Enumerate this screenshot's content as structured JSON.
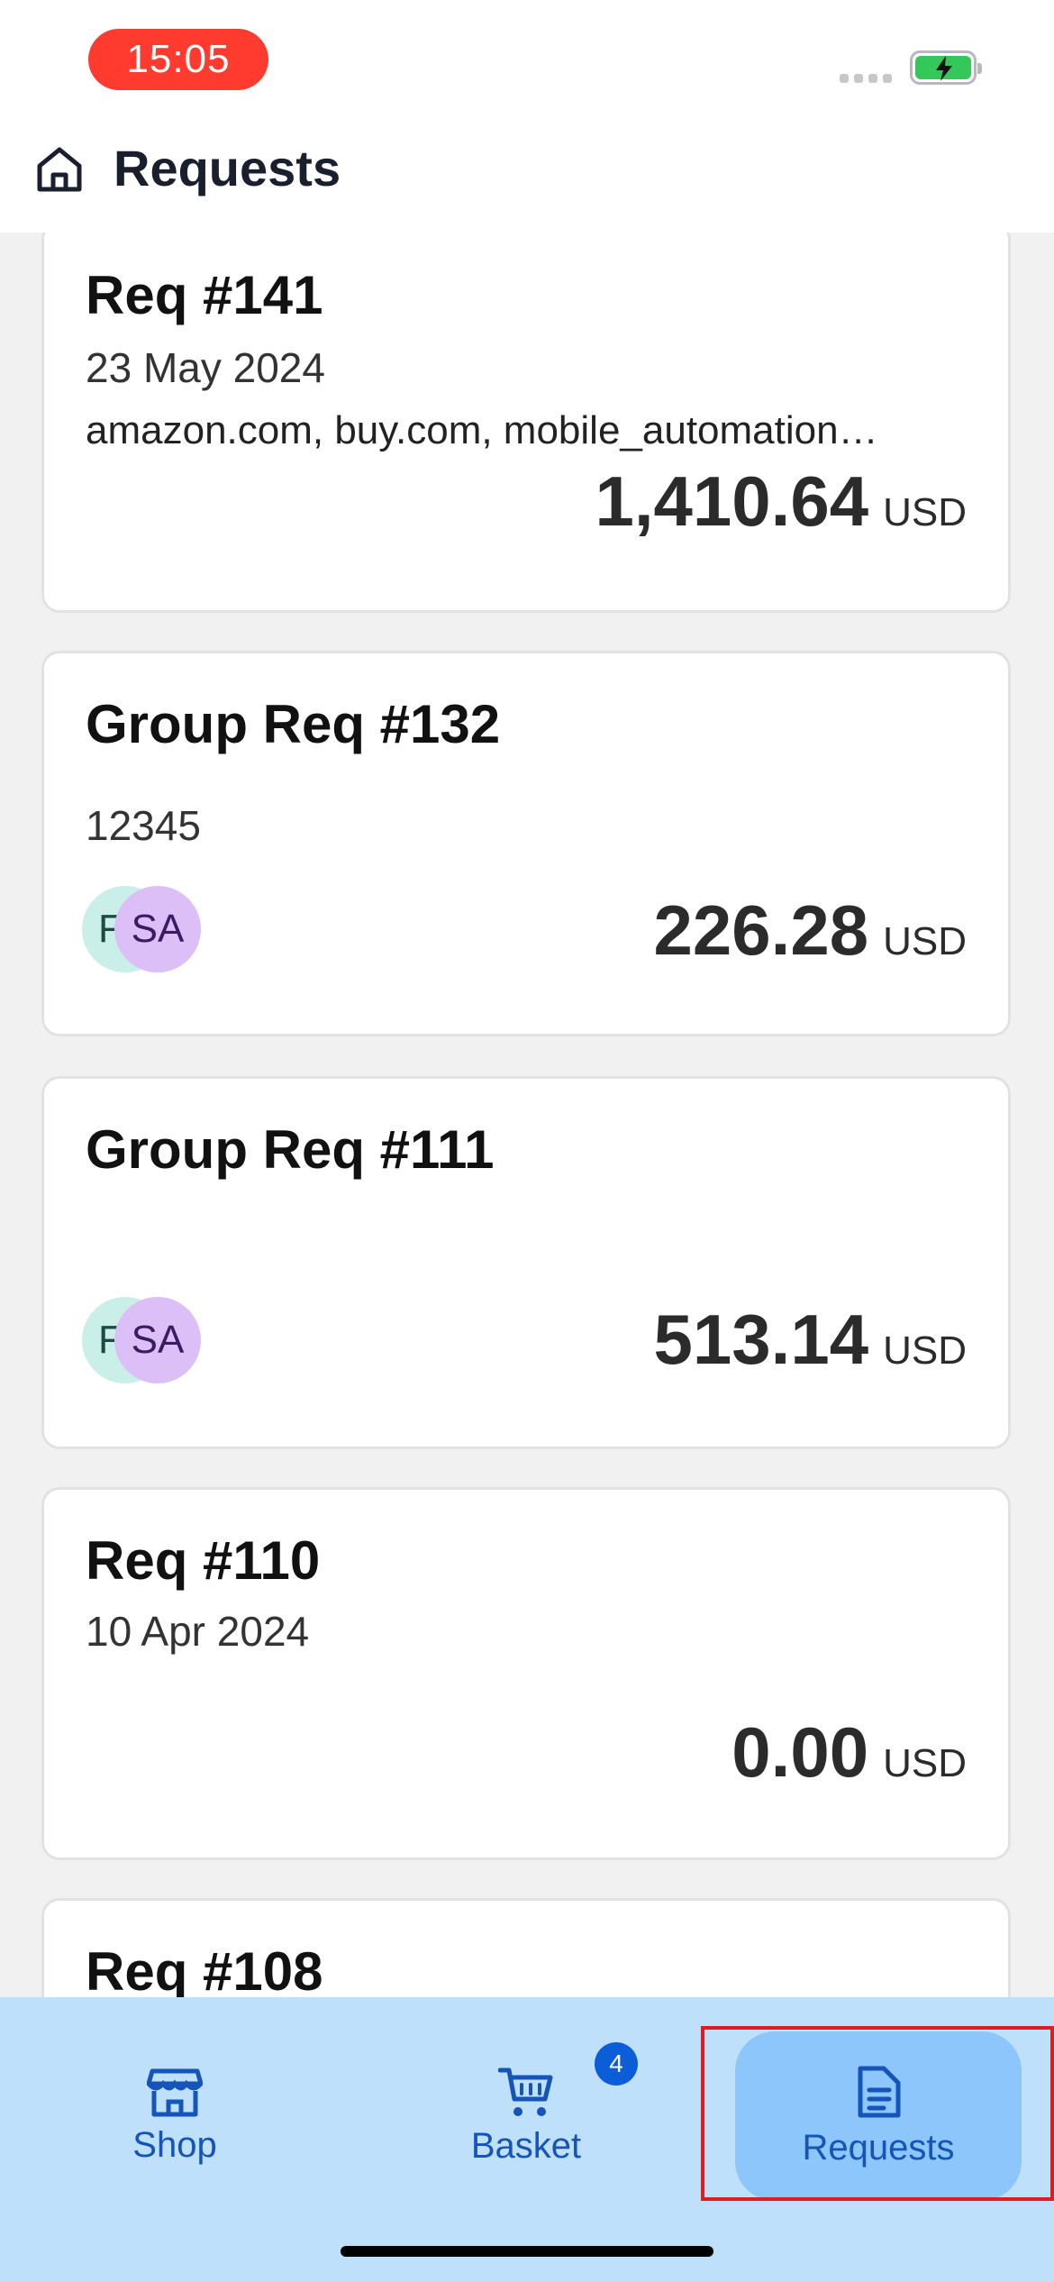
{
  "status_bar": {
    "time": "15:05"
  },
  "header": {
    "title": "Requests"
  },
  "requests": [
    {
      "title": "Req #141",
      "date": "23 May 2024",
      "vendors": "amazon.com, buy.com, mobile_automation…",
      "amount": "1,410.64",
      "currency": "USD"
    },
    {
      "title": "Group Req #132",
      "code": "12345",
      "avatars": [
        "F",
        "SA"
      ],
      "amount": "226.28",
      "currency": "USD"
    },
    {
      "title": "Group Req #111",
      "avatars": [
        "F",
        "SA"
      ],
      "amount": "513.14",
      "currency": "USD"
    },
    {
      "title": "Req #110",
      "date": "10 Apr 2024",
      "amount": "0.00",
      "currency": "USD"
    },
    {
      "title": "Req #108"
    }
  ],
  "nav": {
    "shop": "Shop",
    "basket": "Basket",
    "basket_badge": "4",
    "requests": "Requests"
  },
  "colors": {
    "accent": "#1554b8",
    "nav_bg": "#bfe0fb",
    "nav_active": "#8dc6fa",
    "time_pill": "#ff3b30",
    "highlight": "#e11b22"
  }
}
